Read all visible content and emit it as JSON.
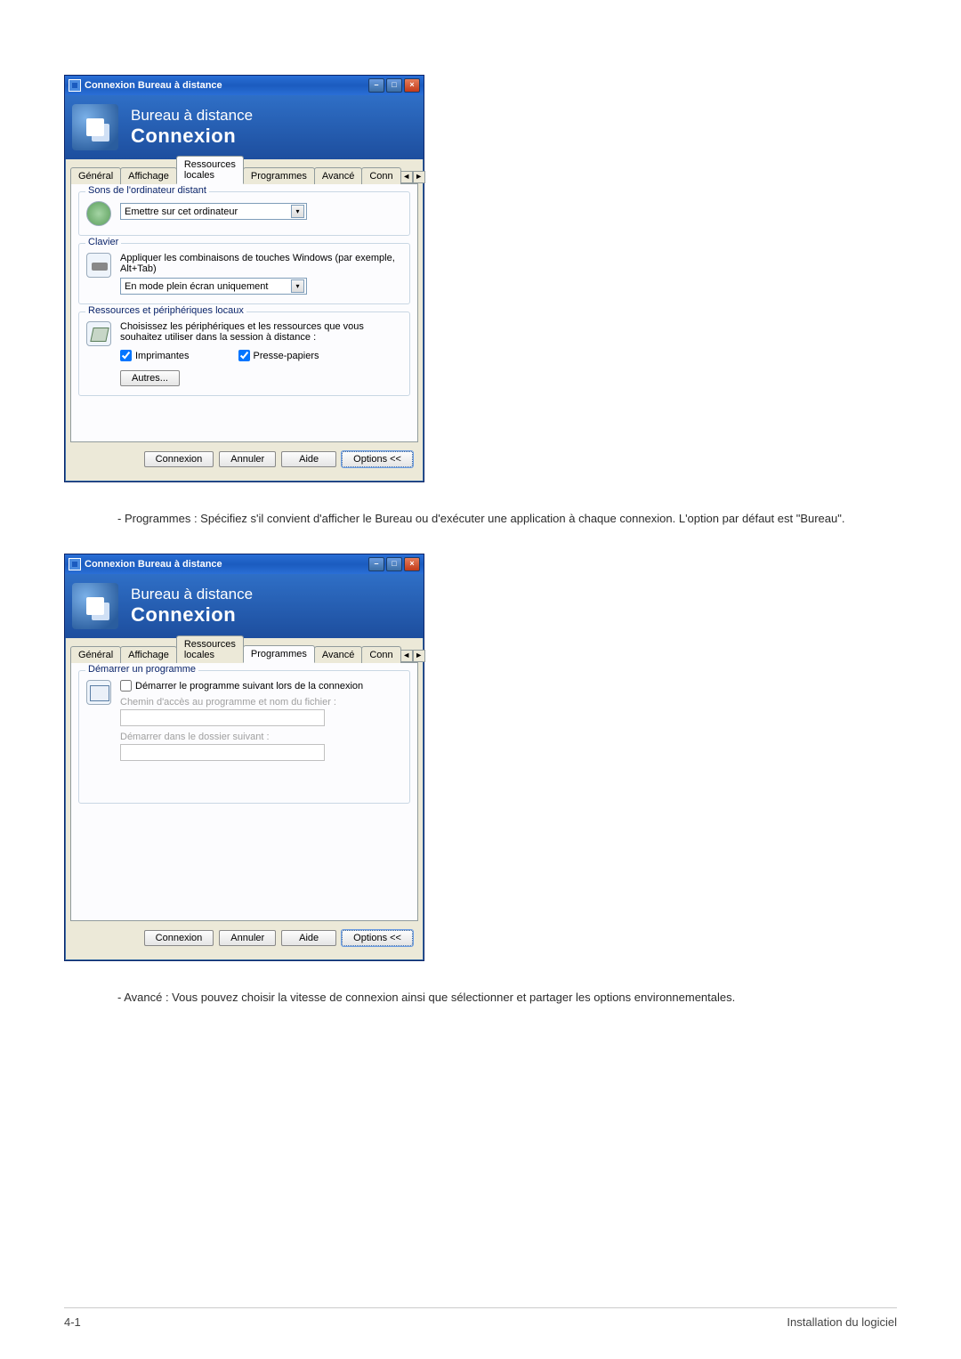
{
  "window_title": "Connexion Bureau à distance",
  "banner": {
    "line1": "Bureau à distance",
    "line2": "Connexion"
  },
  "win_controls": {
    "minimize": "–",
    "maximize": "□",
    "close": "×"
  },
  "tabs": {
    "general": "Général",
    "affichage": "Affichage",
    "ressources": "Ressources locales",
    "programmes": "Programmes",
    "avance": "Avancé",
    "conn": "Conn"
  },
  "resources_tab": {
    "sound_group": "Sons de l'ordinateur distant",
    "sound_select": "Emettre sur cet ordinateur",
    "keyboard_group": "Clavier",
    "keyboard_desc": "Appliquer les combinaisons de touches Windows (par exemple, Alt+Tab)",
    "keyboard_select": "En mode plein écran uniquement",
    "devices_group": "Ressources et périphériques locaux",
    "devices_desc": "Choisissez les périphériques et les ressources que vous souhaitez utiliser dans la session à distance :",
    "printers": "Imprimantes",
    "clipboard": "Presse-papiers",
    "more_btn": "Autres..."
  },
  "programs_tab": {
    "group": "Démarrer un programme",
    "checkbox": "Démarrer le programme suivant lors de la connexion",
    "path_label": "Chemin d'accès au programme et nom du fichier :",
    "folder_label": "Démarrer dans le dossier suivant :"
  },
  "buttons": {
    "connect": "Connexion",
    "cancel": "Annuler",
    "help": "Aide",
    "options": "Options <<"
  },
  "captions": {
    "programmes": "- Programmes : Spécifiez s'il convient d'afficher le Bureau ou d'exécuter une application à chaque connexion. L'option par défaut est \"Bureau\".",
    "avance": "- Avancé  : Vous pouvez choisir la vitesse de connexion ainsi que sélectionner et partager les options environnementales."
  },
  "footer": {
    "left": "4-1",
    "right": "Installation du logiciel"
  }
}
